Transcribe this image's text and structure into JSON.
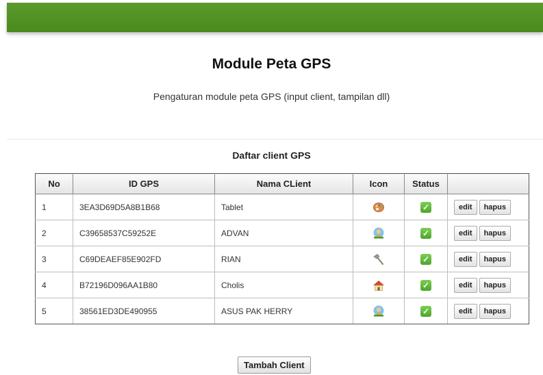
{
  "header": {
    "title": "Module Peta GPS",
    "subtitle": "Pengaturan module peta GPS (input client, tampilan dll)"
  },
  "table": {
    "caption": "Daftar client GPS",
    "columns": [
      "No",
      "ID GPS",
      "Nama CLient",
      "Icon",
      "Status",
      ""
    ],
    "rows": [
      {
        "no": "1",
        "id": "3EA3D69D5A8B1B68",
        "name": "Tablet",
        "icon": "palette-icon",
        "status": "active",
        "edit": "edit",
        "delete": "hapus"
      },
      {
        "no": "2",
        "id": "C39658537C59252E",
        "name": "ADVAN",
        "icon": "user-icon",
        "status": "active",
        "edit": "edit",
        "delete": "hapus"
      },
      {
        "no": "3",
        "id": "C69DEAEF85E902FD",
        "name": "RIAN",
        "icon": "hammer-icon",
        "status": "active",
        "edit": "edit",
        "delete": "hapus"
      },
      {
        "no": "4",
        "id": "B72196D096AA1B80",
        "name": "Cholis",
        "icon": "home-icon",
        "status": "active",
        "edit": "edit",
        "delete": "hapus"
      },
      {
        "no": "5",
        "id": "38561ED3DE490955",
        "name": "ASUS PAK HERRY",
        "icon": "user-icon",
        "status": "active",
        "edit": "edit",
        "delete": "hapus"
      }
    ]
  },
  "actions": {
    "add_label": "Tambah Client"
  },
  "colors": {
    "header_bar": "#4f8f22",
    "status_ok": "#5cb534"
  }
}
